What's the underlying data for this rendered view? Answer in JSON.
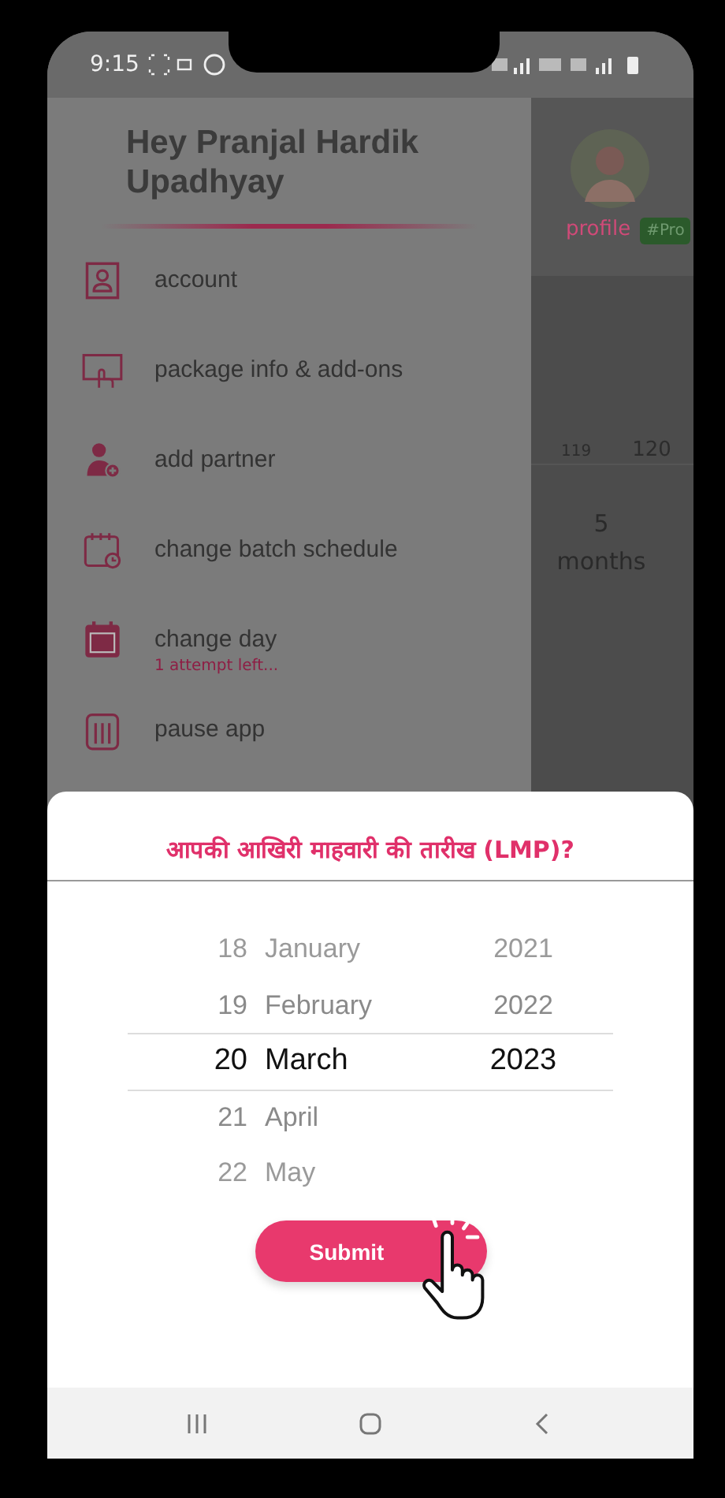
{
  "status_bar": {
    "time": "9:15"
  },
  "drawer": {
    "greeting": "Hey Pranjal Hardik Upadhyay",
    "items": [
      {
        "label": "account"
      },
      {
        "label": "package info & add-ons"
      },
      {
        "label": "add partner"
      },
      {
        "label": "change batch schedule"
      },
      {
        "label": "change day",
        "note": "1 attempt left..."
      },
      {
        "label": "pause app"
      }
    ]
  },
  "background": {
    "profile_label": "profile",
    "tag": "#Pro",
    "numbers": [
      "119",
      "120"
    ],
    "duration_value": "5",
    "duration_unit": "months"
  },
  "date_sheet": {
    "title": "आपकी आखिरी माहवारी की तारीख (LMP)?",
    "days": [
      {
        "label": "18",
        "selected": false
      },
      {
        "label": "19",
        "selected": false
      },
      {
        "label": "20",
        "selected": true
      },
      {
        "label": "21",
        "selected": false
      },
      {
        "label": "22",
        "selected": false
      }
    ],
    "months": [
      {
        "label": "January",
        "selected": false
      },
      {
        "label": "February",
        "selected": false
      },
      {
        "label": "March",
        "selected": true
      },
      {
        "label": "April",
        "selected": false
      },
      {
        "label": "May",
        "selected": false
      }
    ],
    "years": [
      {
        "label": "2021",
        "selected": false
      },
      {
        "label": "2022",
        "selected": false
      },
      {
        "label": "2023",
        "selected": true
      }
    ],
    "submit": "Submit"
  }
}
